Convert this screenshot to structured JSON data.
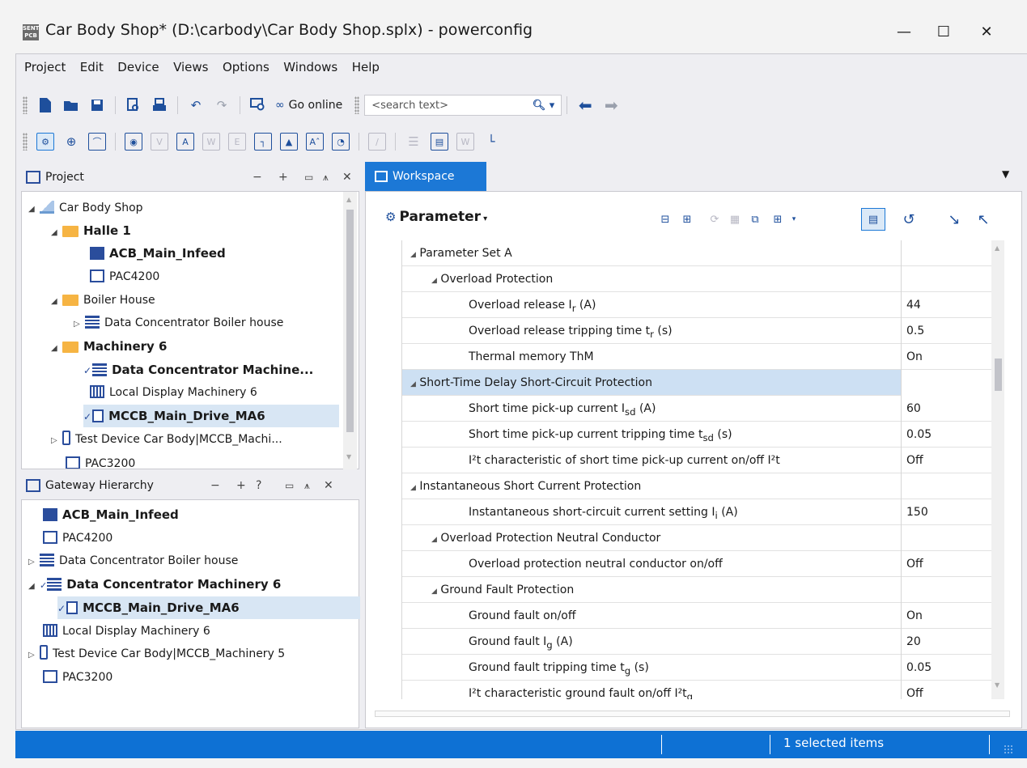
{
  "window": {
    "app_icon_label": "SENT PCB",
    "title": "Car Body Shop* (D:\\carbody\\Car Body Shop.splx) - powerconfig",
    "minimize": "—",
    "maximize": "☐",
    "close": "✕"
  },
  "menu": [
    "Project",
    "Edit",
    "Device",
    "Views",
    "Options",
    "Windows",
    "Help"
  ],
  "toolbar": {
    "go_online_label": "Go online",
    "search_placeholder": "<search text>"
  },
  "project_panel": {
    "title": "Project",
    "items": [
      {
        "label": "Car Body Shop"
      },
      {
        "label": "Halle 1"
      },
      {
        "label": "ACB_Main_Infeed"
      },
      {
        "label": "PAC4200"
      },
      {
        "label": "Boiler House"
      },
      {
        "label": "Data Concentrator Boiler house"
      },
      {
        "label": "Machinery 6"
      },
      {
        "label": "Data Concentrator Machine..."
      },
      {
        "label": "Local Display Machinery 6"
      },
      {
        "label": "MCCB_Main_Drive_MA6"
      },
      {
        "label": "Test Device Car Body|MCCB_Machi..."
      },
      {
        "label": "PAC3200"
      }
    ]
  },
  "gateway_panel": {
    "title": "Gateway Hierarchy",
    "help_glyph": "?",
    "items": [
      {
        "label": "ACB_Main_Infeed"
      },
      {
        "label": "PAC4200"
      },
      {
        "label": "Data Concentrator Boiler house"
      },
      {
        "label": "Data Concentrator Machinery 6"
      },
      {
        "label": "MCCB_Main_Drive_MA6"
      },
      {
        "label": "Local Display Machinery 6"
      },
      {
        "label": "Test Device Car Body|MCCB_Machinery 5"
      },
      {
        "label": "PAC3200"
      }
    ]
  },
  "workspace": {
    "tab_label": "Workspace",
    "param_title": "Parameter",
    "rows": [
      {
        "name": "Parameter Set A",
        "value": ""
      },
      {
        "name": "Overload Protection",
        "value": ""
      },
      {
        "name": "Overload release I",
        "sub": "r",
        "suffix": " (A)",
        "value": "44"
      },
      {
        "name": "Overload release tripping time t",
        "sub": "r",
        "suffix": " (s)",
        "value": "0.5"
      },
      {
        "name": "Thermal memory ThM",
        "value": "On"
      },
      {
        "name": "Short-Time Delay Short-Circuit Protection",
        "value": ""
      },
      {
        "name": "Short time pick-up current I",
        "sub": "sd",
        "suffix": " (A)",
        "value": "60"
      },
      {
        "name": "Short time pick-up current tripping time t",
        "sub": "sd",
        "suffix": " (s)",
        "value": "0.05"
      },
      {
        "name": "I²t characteristic of short time pick-up current on/off I²t",
        "value": "Off"
      },
      {
        "name": "Instantaneous Short Current Protection",
        "value": ""
      },
      {
        "name": "Instantaneous short-circuit current setting I",
        "sub": "i",
        "suffix": " (A)",
        "value": "150"
      },
      {
        "name": "Overload Protection Neutral Conductor",
        "value": ""
      },
      {
        "name": "Overload protection neutral conductor on/off",
        "value": "Off"
      },
      {
        "name": "Ground Fault Protection",
        "value": ""
      },
      {
        "name": "Ground fault on/off",
        "value": "On"
      },
      {
        "name": "Ground fault I",
        "sub": "g",
        "suffix": " (A)",
        "value": "20"
      },
      {
        "name": "Ground fault tripping time t",
        "sub": "g",
        "suffix": " (s)",
        "value": "0.05"
      },
      {
        "name": "I²t characteristic ground fault on/off I²t",
        "sub": "g",
        "value": "Off"
      }
    ]
  },
  "status": {
    "selected": "1 selected items"
  },
  "colors": {
    "accent": "#1c78d6",
    "statusbar": "#0e71d4",
    "selection": "#d8e6f4",
    "icon_blue": "#2a4d9c",
    "folder": "#f6b443"
  }
}
